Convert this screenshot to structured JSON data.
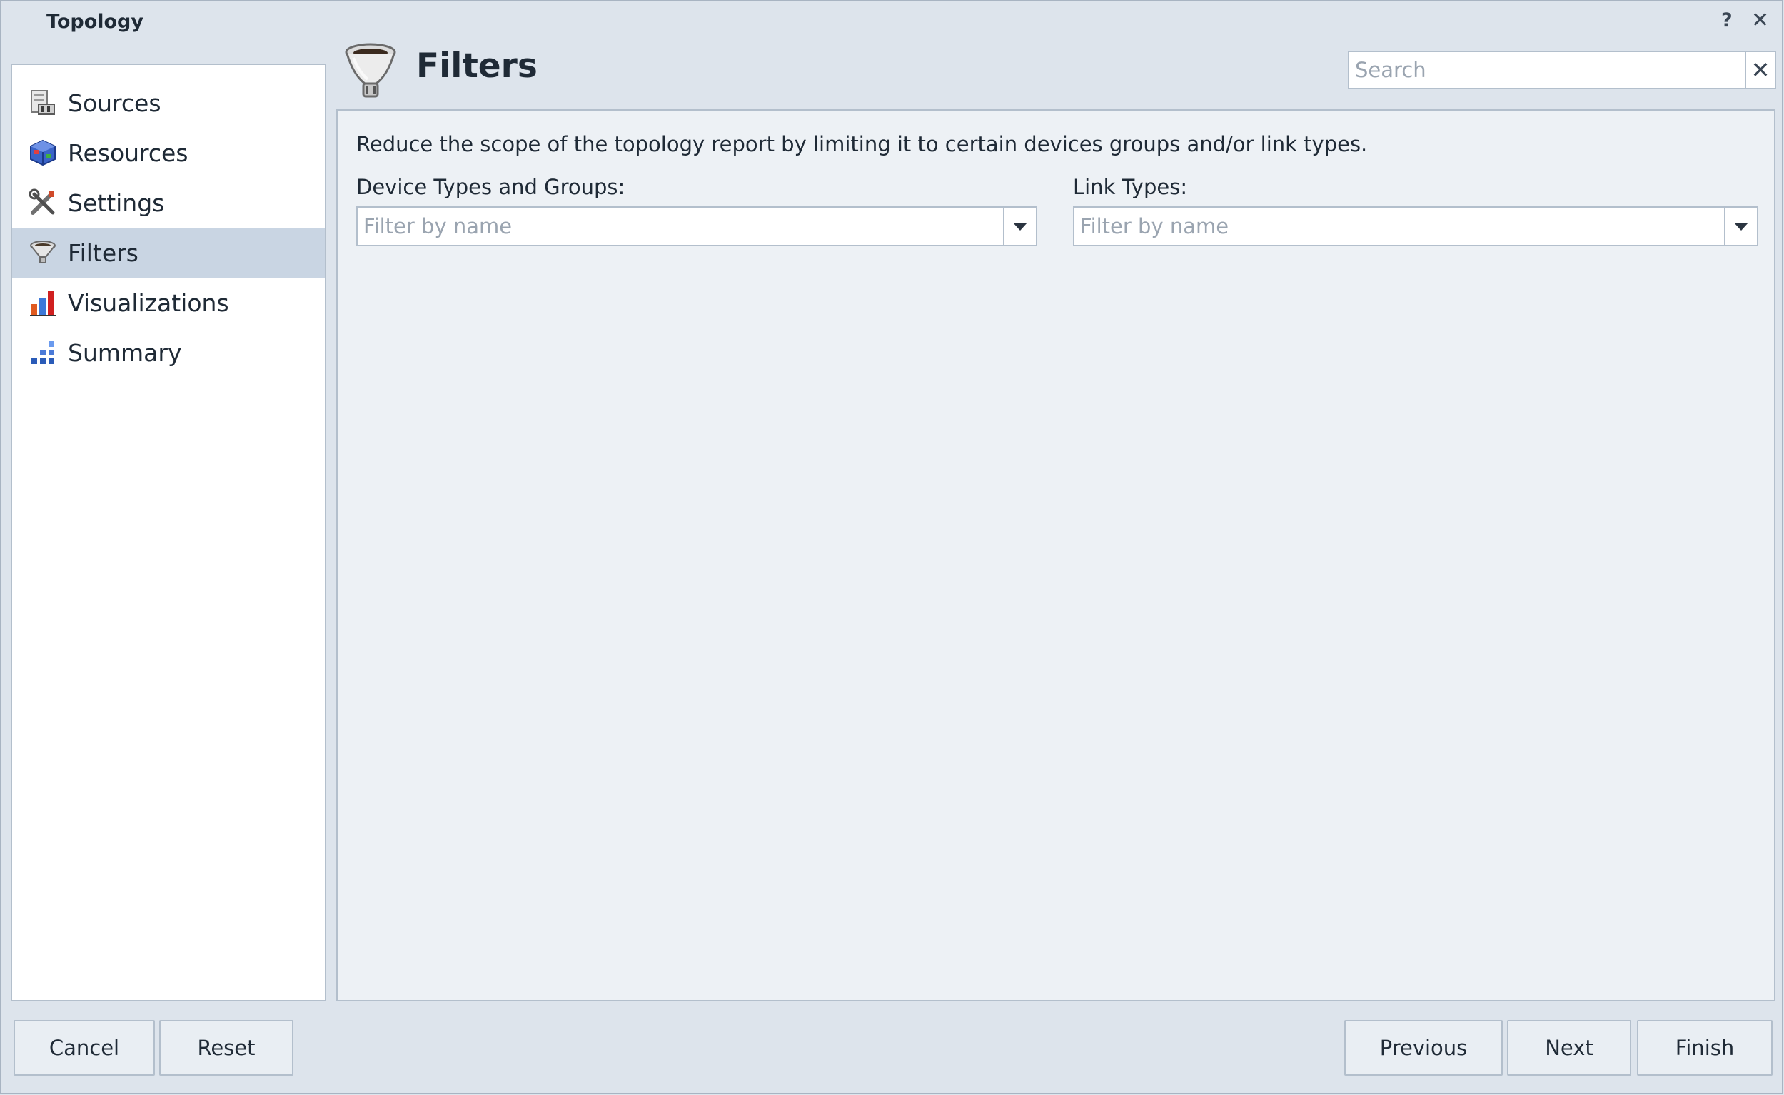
{
  "window": {
    "title": "Topology",
    "help_label": "?",
    "close_label": "✕"
  },
  "sidebar": {
    "items": [
      {
        "label": "Sources",
        "icon": "sources-icon"
      },
      {
        "label": "Resources",
        "icon": "resources-icon"
      },
      {
        "label": "Settings",
        "icon": "settings-icon"
      },
      {
        "label": "Filters",
        "icon": "filter-icon",
        "selected": true
      },
      {
        "label": "Visualizations",
        "icon": "visualizations-icon"
      },
      {
        "label": "Summary",
        "icon": "summary-icon"
      }
    ]
  },
  "header": {
    "title": "Filters",
    "icon": "filter-funnel-icon"
  },
  "search": {
    "placeholder": "Search",
    "value": "",
    "clear_label": "✕"
  },
  "main": {
    "description": "Reduce the scope of the topology report by limiting it to certain devices groups and/or link types.",
    "device_types": {
      "label": "Device Types and Groups:",
      "placeholder": "Filter by name",
      "value": ""
    },
    "link_types": {
      "label": "Link Types:",
      "placeholder": "Filter by name",
      "value": ""
    }
  },
  "footer": {
    "cancel": "Cancel",
    "reset": "Reset",
    "previous": "Previous",
    "next": "Next",
    "finish": "Finish"
  },
  "colors": {
    "background": "#dde4ec",
    "panel": "#edf1f5",
    "selected": "#c9d5e3",
    "border": "#b3bfcc"
  }
}
